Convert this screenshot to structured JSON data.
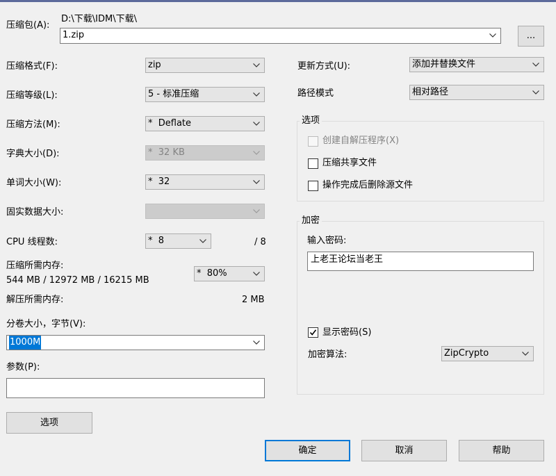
{
  "archive": {
    "label": "压缩包(A):",
    "path": "D:\\下载\\IDM\\下载\\",
    "filename": "1.zip",
    "browse_label": "..."
  },
  "left": {
    "format": {
      "label": "压缩格式(F):",
      "value": "zip"
    },
    "level": {
      "label": "压缩等级(L):",
      "value": "5 - 标准压缩"
    },
    "method": {
      "label": "压缩方法(M):",
      "value": "*  Deflate"
    },
    "dict": {
      "label": "字典大小(D):",
      "value": "*  32 KB"
    },
    "word": {
      "label": "单词大小(W):",
      "value": "*  32"
    },
    "solid": {
      "label": "固实数据大小:",
      "value": ""
    },
    "threads": {
      "label": "CPU 线程数:",
      "value": "*  8",
      "max": "/ 8"
    },
    "mem_compress": {
      "label": "压缩所需内存:",
      "value": "544 MB / 12972 MB / 16215 MB",
      "percent": "*  80%"
    },
    "mem_decompress": {
      "label": "解压所需内存:",
      "value": "2 MB"
    },
    "volume": {
      "label": "分卷大小，字节(V):",
      "value": "1000M"
    },
    "params": {
      "label": "参数(P):",
      "value": ""
    },
    "options_button": "选项"
  },
  "right": {
    "update": {
      "label": "更新方式(U):",
      "value": "添加并替换文件"
    },
    "pathmode": {
      "label": "路径模式",
      "value": "相对路径"
    },
    "options_group": {
      "title": "选项",
      "sfx": {
        "label": "创建自解压程序(X)",
        "checked": false,
        "disabled": true
      },
      "shared": {
        "label": "压缩共享文件",
        "checked": false
      },
      "delete": {
        "label": "操作完成后删除源文件",
        "checked": false
      }
    },
    "encryption": {
      "title": "加密",
      "password_label": "输入密码:",
      "password_value": "上老王论坛当老王",
      "show_password": {
        "label": "显示密码(S)",
        "checked": true
      },
      "method_label": "加密算法:",
      "method_value": "ZipCrypto"
    }
  },
  "buttons": {
    "ok": "确定",
    "cancel": "取消",
    "help": "帮助"
  },
  "colors": {
    "accent": "#0078d7",
    "titlebar": "#5c6a9b",
    "background": "#f0f0f0"
  }
}
